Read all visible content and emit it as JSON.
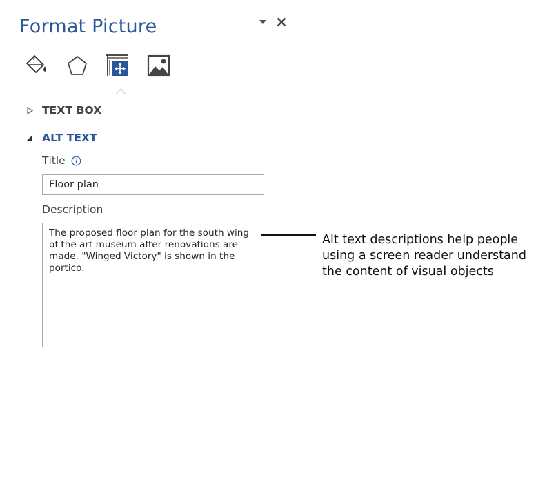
{
  "pane": {
    "title": "Format Picture",
    "tabs": [
      {
        "icon": "fill-line-icon"
      },
      {
        "icon": "effects-pentagon-icon"
      },
      {
        "icon": "size-properties-icon",
        "selected": true
      },
      {
        "icon": "picture-icon"
      }
    ],
    "sections": {
      "text_box": {
        "label": "TEXT BOX",
        "expanded": false
      },
      "alt_text": {
        "label": "ALT TEXT",
        "expanded": true
      }
    },
    "fields": {
      "title_label_first": "T",
      "title_label_rest": "itle",
      "title_value": "Floor plan",
      "description_label_first": "D",
      "description_label_rest": "escription",
      "description_value": "The proposed floor plan for the south wing of the art museum after renovations are made. \"Winged Victory\" is shown in the portico."
    }
  },
  "callout": {
    "text": "Alt text descriptions help people\nusing a screen reader understand\nthe content of visual objects"
  },
  "colors": {
    "accent": "#2b579a",
    "selected_tab": "#2b579a"
  }
}
